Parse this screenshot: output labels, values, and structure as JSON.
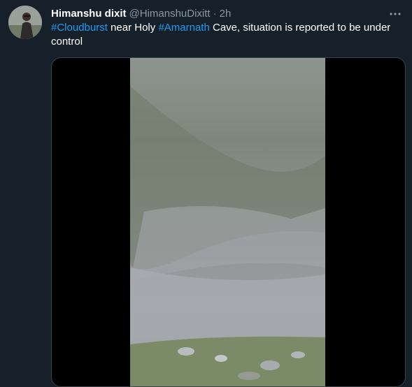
{
  "tweet": {
    "author_name": "Himanshu dixit",
    "author_handle": "@HimanshuDixitt",
    "separator": "·",
    "timestamp": "2h",
    "more_icon": "more-horizontal-icon",
    "text_parts": {
      "tag1": "#Cloudburst",
      "mid": " near Holy ",
      "tag2": "#Amarnath",
      "end": " Cave, situation is reported to be under control"
    }
  },
  "colors": {
    "background": "#15202b",
    "hashtag": "#1d9bf0",
    "secondary_text": "#8b98a5"
  }
}
